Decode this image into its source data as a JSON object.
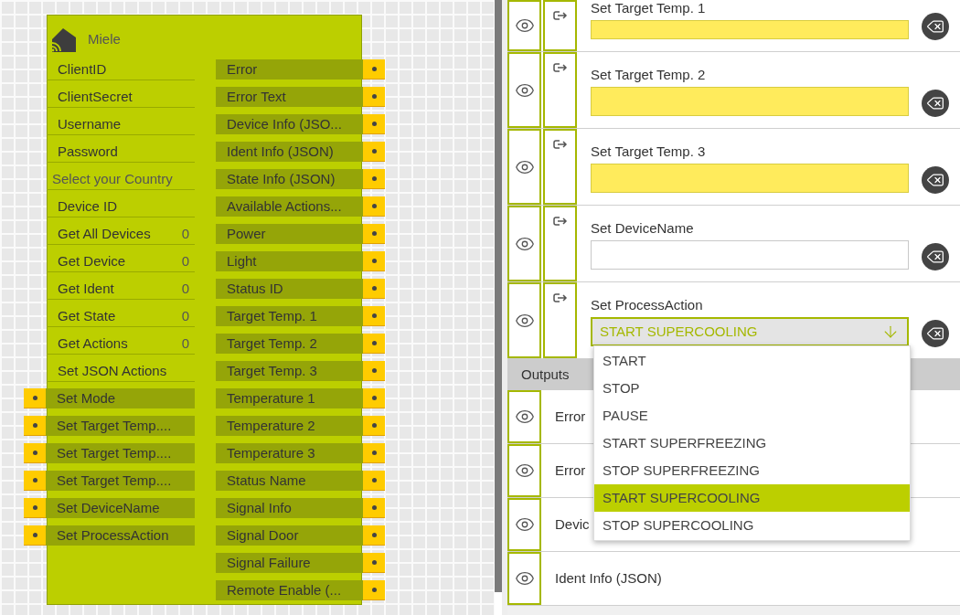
{
  "node": {
    "title": "Miele",
    "inputs": [
      {
        "label": "ClientID",
        "kind": "field"
      },
      {
        "label": "ClientSecret",
        "kind": "field"
      },
      {
        "label": "Username",
        "kind": "field"
      },
      {
        "label": "Password",
        "kind": "field"
      },
      {
        "label": "Select your Country",
        "kind": "select"
      },
      {
        "label": "Device ID",
        "kind": "field"
      },
      {
        "label": "Get All Devices",
        "kind": "field",
        "value": "0"
      },
      {
        "label": "Get Device",
        "kind": "field",
        "value": "0"
      },
      {
        "label": "Get Ident",
        "kind": "field",
        "value": "0"
      },
      {
        "label": "Get State",
        "kind": "field",
        "value": "0"
      },
      {
        "label": "Get Actions",
        "kind": "field",
        "value": "0"
      },
      {
        "label": "Set JSON Actions",
        "kind": "field"
      },
      {
        "label": "Set Mode",
        "kind": "port"
      },
      {
        "label": "Set Target Temp....",
        "kind": "port"
      },
      {
        "label": "Set Target Temp....",
        "kind": "port"
      },
      {
        "label": "Set Target Temp....",
        "kind": "port"
      },
      {
        "label": "Set DeviceName",
        "kind": "port"
      },
      {
        "label": "Set ProcessAction",
        "kind": "port"
      }
    ],
    "outputs": [
      "Error",
      "Error Text",
      "Device Info (JSO...",
      "Ident Info (JSON)",
      "State Info (JSON)",
      "Available Actions...",
      "Power",
      "Light",
      "Status ID",
      "Target Temp. 1",
      "Target Temp. 2",
      "Target Temp. 3",
      "Temperature 1",
      "Temperature 2",
      "Temperature 3",
      "Status Name",
      "Signal Info",
      "Signal Door",
      "Signal Failure",
      "Remote Enable (..."
    ]
  },
  "panel": {
    "inputs": [
      {
        "label": "Set Target Temp. 1",
        "kind": "text",
        "highlighted": true
      },
      {
        "label": "Set Target Temp. 2",
        "kind": "text",
        "highlighted": true
      },
      {
        "label": "Set Target Temp. 3",
        "kind": "text",
        "highlighted": true
      },
      {
        "label": "Set DeviceName",
        "kind": "text",
        "highlighted": false
      },
      {
        "label": "Set ProcessAction",
        "kind": "select",
        "value": "START SUPERCOOLING",
        "expanded": true,
        "options": [
          {
            "label": "START",
            "selected": false
          },
          {
            "label": "STOP",
            "selected": false
          },
          {
            "label": "PAUSE",
            "selected": false
          },
          {
            "label": "START SUPERFREEZING",
            "selected": false
          },
          {
            "label": "STOP SUPERFREEZING",
            "selected": false
          },
          {
            "label": "START SUPERCOOLING",
            "selected": true
          },
          {
            "label": "STOP SUPERCOOLING",
            "selected": false
          }
        ]
      }
    ],
    "outputs_header": "Outputs",
    "outputs": [
      "Error",
      "Error",
      "Devic",
      "Ident Info (JSON)"
    ]
  }
}
